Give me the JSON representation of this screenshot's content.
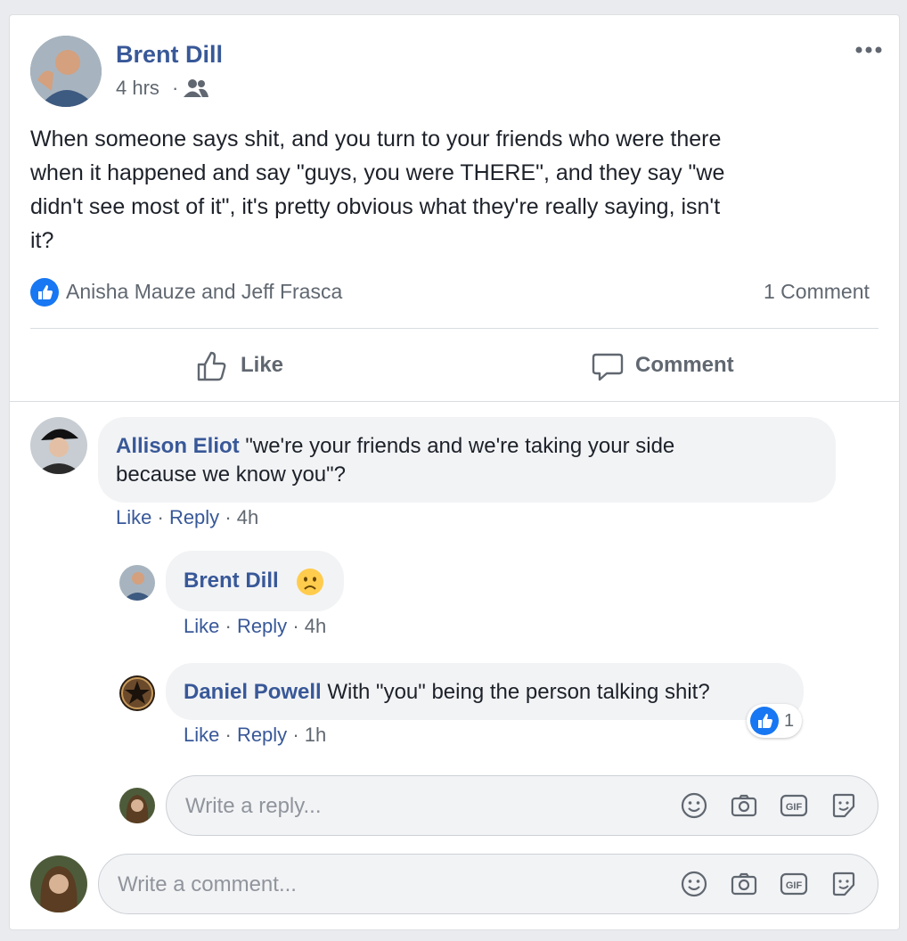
{
  "post": {
    "author": "Brent Dill",
    "time": "4 hrs",
    "audience_icon": "friends-icon",
    "more_icon": "more-horizontal-icon",
    "text_lines": [
      "When someone says shit, and you turn to your friends who were there",
      "when it happened and say \"guys, you were THERE\", and they say \"we",
      "didn't see most of it\", it's pretty obvious what they're really saying, isn't",
      "it?"
    ],
    "reactions_names": "Anisha Mauze and Jeff Frasca",
    "comment_count": "1 Comment",
    "actions": {
      "like": "Like",
      "comment": "Comment"
    }
  },
  "comments": {
    "c1": {
      "author": "Allison Eliot",
      "text_line1": "\"we're your friends and we're taking your side",
      "text_line2": "because we know you\"?",
      "like": "Like",
      "sep1": "·",
      "reply": "Reply",
      "sep2": "·",
      "time": "4h"
    },
    "r1": {
      "author": "Brent Dill",
      "emoji": "worried-face-emoji",
      "like": "Like",
      "sep1": "·",
      "reply": "Reply",
      "sep2": "·",
      "time": "4h"
    },
    "r2": {
      "author": "Daniel Powell",
      "text": "With \"you\" being the person talking shit?",
      "like_count": "1",
      "like": "Like",
      "sep1": "·",
      "reply": "Reply",
      "sep2": "·",
      "time": "1h"
    }
  },
  "reply_box": {
    "placeholder": "Write a reply..."
  },
  "comment_box": {
    "placeholder": "Write a comment..."
  },
  "colors": {
    "link": "#385898",
    "like_blue": "#1877f2",
    "bubble": "#f2f3f5"
  }
}
